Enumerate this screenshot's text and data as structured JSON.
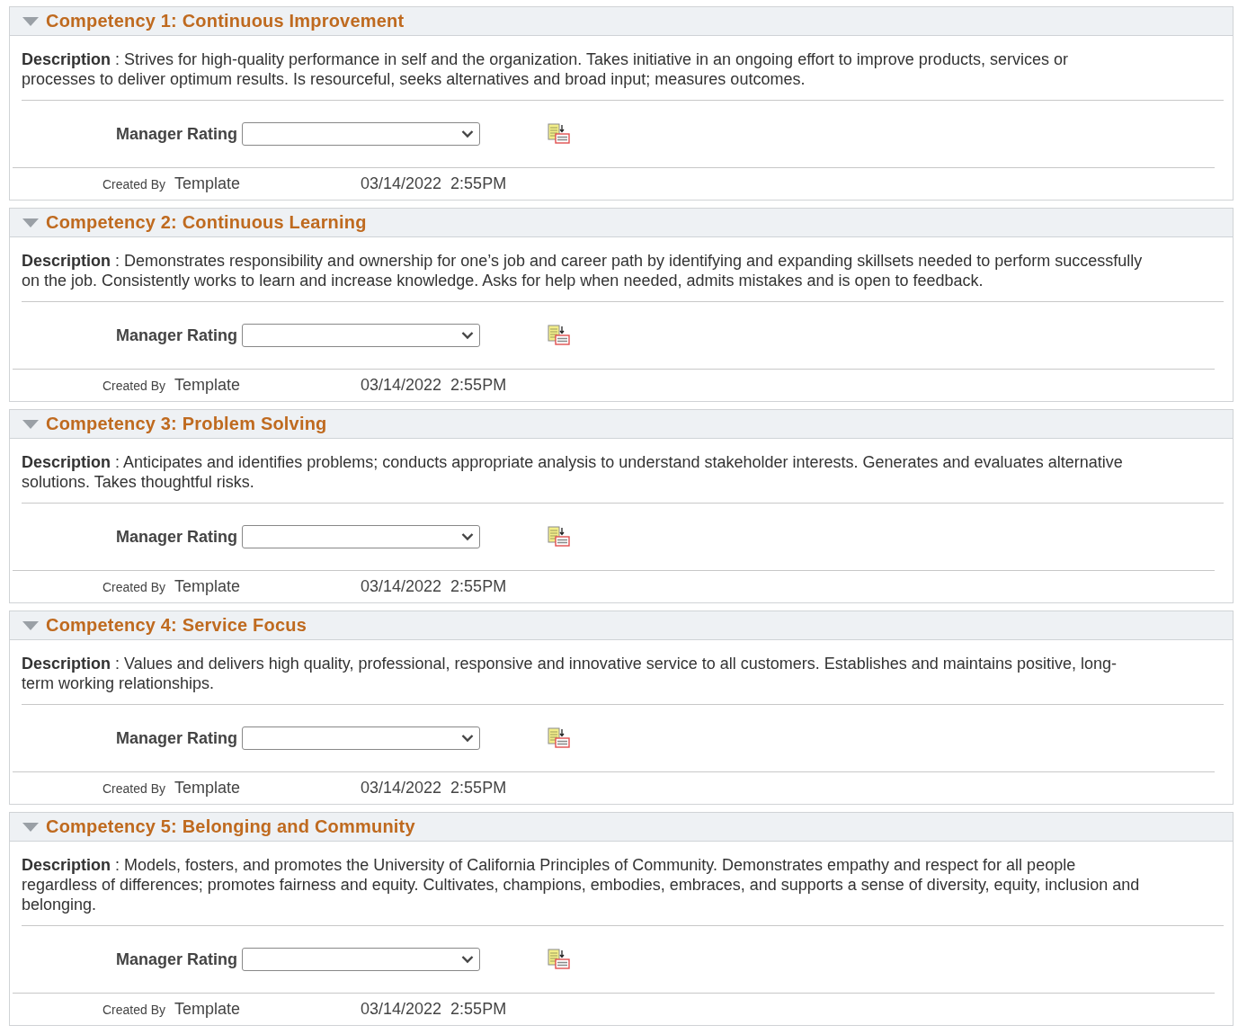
{
  "competencies": [
    {
      "title": "Competency 1: Continuous Improvement",
      "expanded": true,
      "description": "**Description** : Strives for high-quality performance in self and the organization. Takes initiative in an ongoing effort to improve products, services or processes to deliver optimum results. Is resourceful, seeks alternatives and broad input; measures outcomes.",
      "rating_label": "Manager Rating",
      "created_by_label": "Created By",
      "created_by": "Template",
      "date": "03/14/2022",
      "time": "2:55PM"
    },
    {
      "title": "Competency 2: Continuous Learning",
      "expanded": true,
      "description": "**Description** : Demonstrates responsibility and ownership for one’s job and career path by identifying and expanding skillsets needed to perform successfully on the job. Consistently works to learn and increase knowledge. Asks for help when needed, admits mistakes and is open to feedback.",
      "rating_label": "Manager Rating",
      "created_by_label": "Created By",
      "created_by": "Template",
      "date": "03/14/2022",
      "time": "2:55PM"
    },
    {
      "title": "Competency 3: Problem Solving",
      "expanded": true,
      "description": "**Description** : Anticipates and identifies problems; conducts appropriate analysis to understand stakeholder interests. Generates and evaluates alternative solutions. Takes thoughtful risks.",
      "rating_label": "Manager Rating",
      "created_by_label": "Created By",
      "created_by": "Template",
      "date": "03/14/2022",
      "time": "2:55PM"
    },
    {
      "title": "Competency 4: Service Focus",
      "expanded": true,
      "description": "**Description** : Values and delivers high quality, professional, responsive and innovative service to all customers. Establishes and maintains positive, long-term working relationships.",
      "rating_label": "Manager Rating",
      "created_by_label": "Created By",
      "created_by": "Template",
      "date": "03/14/2022",
      "time": "2:55PM"
    },
    {
      "title": "Competency 5: Belonging and Community",
      "expanded": true,
      "description": "**Description** : Models, fosters, and promotes the University of California Principles of Community. Demonstrates empathy and respect for all people regardless of differences; promotes fairness and equity. Cultivates, champions, embodies, embraces, and supports a sense of diversity, equity, inclusion and belonging.",
      "rating_label": "Manager Rating",
      "created_by_label": "Created By",
      "created_by": "Template",
      "date": "03/14/2022",
      "time": "2:55PM"
    }
  ]
}
